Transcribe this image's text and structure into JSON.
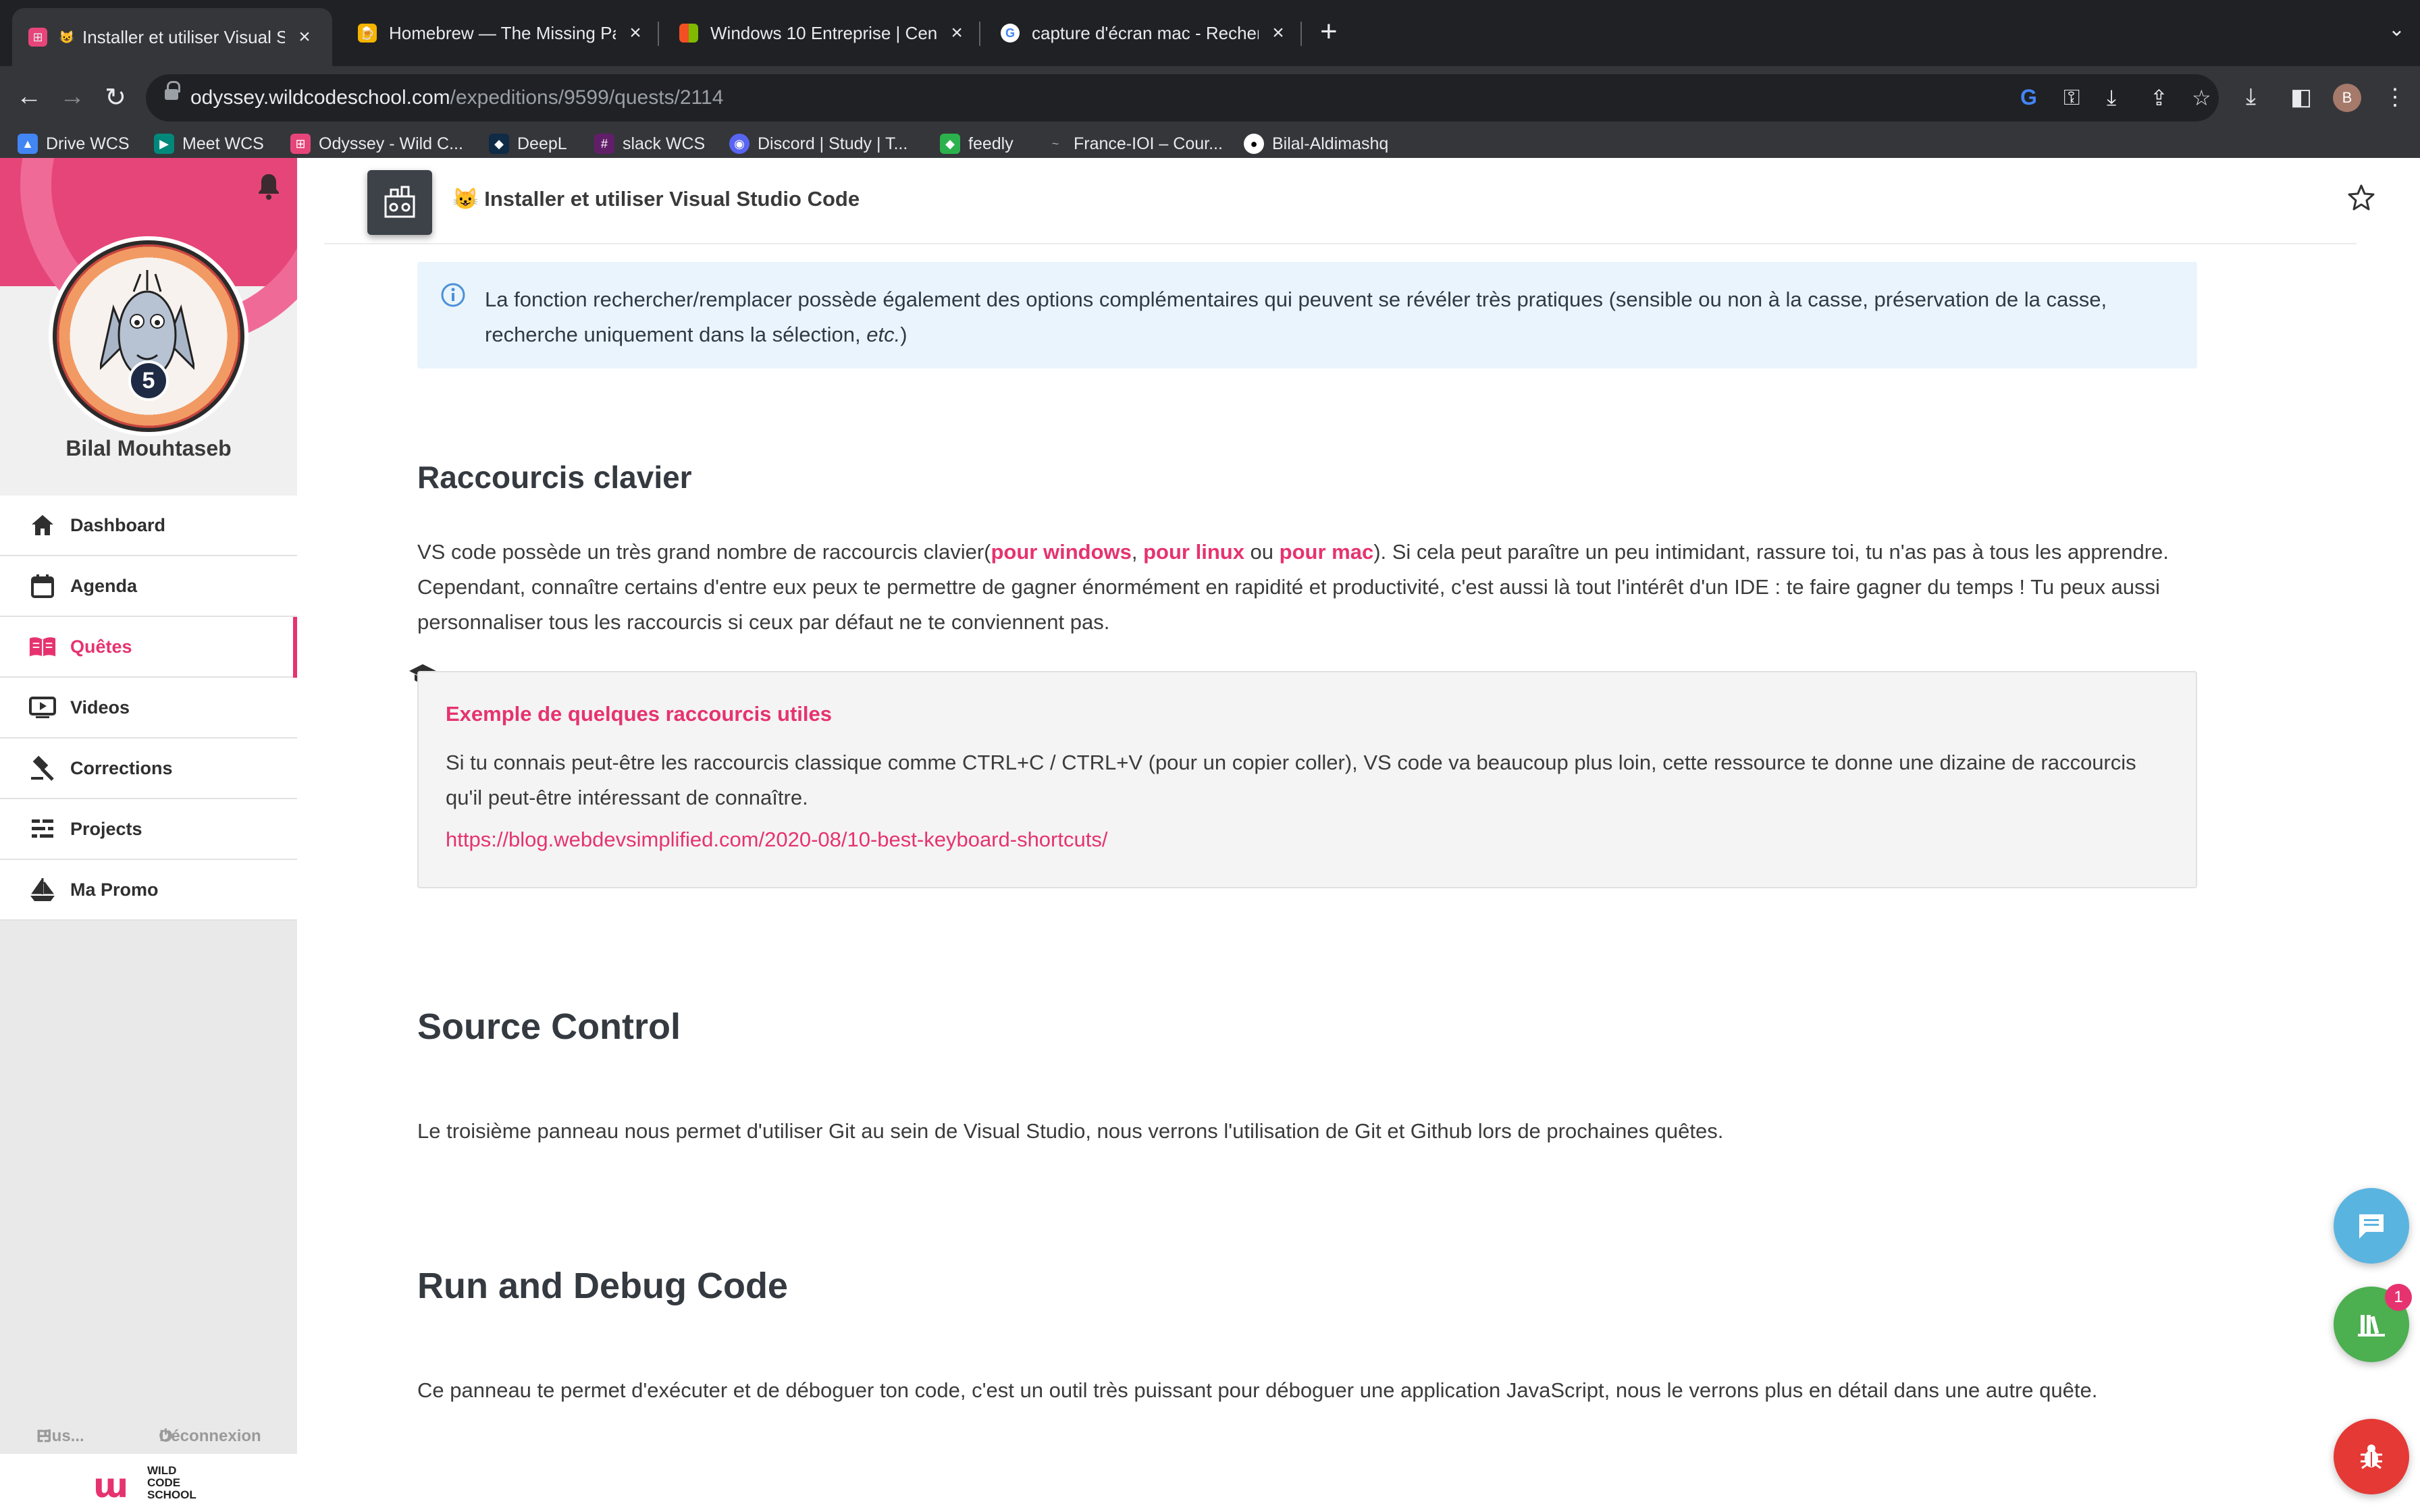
{
  "browser": {
    "tabs": [
      {
        "title": "Installer et utiliser Visual St",
        "active": true
      },
      {
        "title": "Homebrew — The Missing Pac",
        "active": false
      },
      {
        "title": "Windows 10 Entreprise | Centr",
        "active": false
      },
      {
        "title": "capture d'écran mac - Recher",
        "active": false
      }
    ],
    "new_tab": "+",
    "url_host": "odyssey.wildcodeschool.com",
    "url_path": "/expeditions/9599/quests/2114",
    "profile_initial": "B",
    "bookmarks": [
      {
        "label": "Drive WCS",
        "color": "#4285f4"
      },
      {
        "label": "Meet WCS",
        "color": "#00897b"
      },
      {
        "label": "Odyssey - Wild C...",
        "color": "#e6457a"
      },
      {
        "label": "DeepL",
        "color": "#0f2b46"
      },
      {
        "label": "slack WCS",
        "color": "#611f69"
      },
      {
        "label": "Discord | Study | T...",
        "color": "#5865f2"
      },
      {
        "label": "feedly",
        "color": "#2bb24c"
      },
      {
        "label": "France-IOI – Cour...",
        "color": "#35363a"
      },
      {
        "label": "Bilal-Aldimashq",
        "color": "#35363a"
      }
    ]
  },
  "sidebar": {
    "user_name": "Bilal Mouhtaseb",
    "level": "5",
    "items": [
      {
        "label": "Dashboard",
        "icon": "home-icon",
        "active": false
      },
      {
        "label": "Agenda",
        "icon": "calendar-icon",
        "active": false
      },
      {
        "label": "Quêtes",
        "icon": "book-icon",
        "active": true
      },
      {
        "label": "Videos",
        "icon": "video-icon",
        "active": false
      },
      {
        "label": "Corrections",
        "icon": "gavel-icon",
        "active": false
      },
      {
        "label": "Projects",
        "icon": "projects-icon",
        "active": false
      },
      {
        "label": "Ma Promo",
        "icon": "ship-icon",
        "active": false
      }
    ],
    "footer_more": "Plus...",
    "footer_logout": "Déconnexion",
    "logo_text": [
      "WILD",
      "CODE",
      "SCHOOL"
    ]
  },
  "quest": {
    "title": "Installer et utiliser Visual Studio Code",
    "info_text_1": "La fonction rechercher/remplacer possède également des options complémentaires qui peuvent se révéler très pratiques (sensible ou non à la casse, préservation de la casse, recherche uniquement dans la sélection, ",
    "info_text_em": "etc.",
    "info_text_2": ")",
    "section1": {
      "title": "Raccourcis clavier",
      "p_before": "VS code possède un très grand nombre de raccourcis clavier(",
      "link_windows": "pour windows",
      "comma": ", ",
      "link_linux": "pour linux",
      "or": " ou ",
      "link_mac": "pour mac",
      "p_after": "). Si cela peut paraître un peu intimidant, rassure toi, tu n'as pas à tous les apprendre. Cependant, connaître certains d'entre eux peux te permettre de gagner énormément en rapidité et productivité, c'est aussi là tout l'intérêt d'un IDE : te faire gagner du temps ! Tu peux aussi personnaliser tous les raccourcis si ceux par défaut ne te conviennent pas."
    },
    "tip": {
      "title": "Exemple de quelques raccourcis utiles",
      "body": "Si tu connais peut-être les raccourcis classique comme CTRL+C / CTRL+V (pour un copier coller), VS code va beaucoup plus loin, cette ressource te donne une dizaine de raccourcis qu'il peut-être intéressant de connaître.",
      "link": "https://blog.webdevsimplified.com/2020-08/10-best-keyboard-shortcuts/"
    },
    "section2": {
      "title": "Source Control",
      "text": "Le troisième panneau nous permet d'utiliser Git au sein de Visual Studio, nous verrons l'utilisation de Git et Github lors de prochaines quêtes."
    },
    "section3": {
      "title": "Run and Debug Code",
      "text": "Ce panneau te permet d'exécuter et de déboguer ton code, c'est un outil très puissant pour déboguer une application JavaScript, nous le verrons plus en détail dans une autre quête."
    }
  },
  "fabs": {
    "library_badge": "1"
  },
  "colors": {
    "accent": "#e6336f",
    "info_bg": "#eaf4fc"
  }
}
